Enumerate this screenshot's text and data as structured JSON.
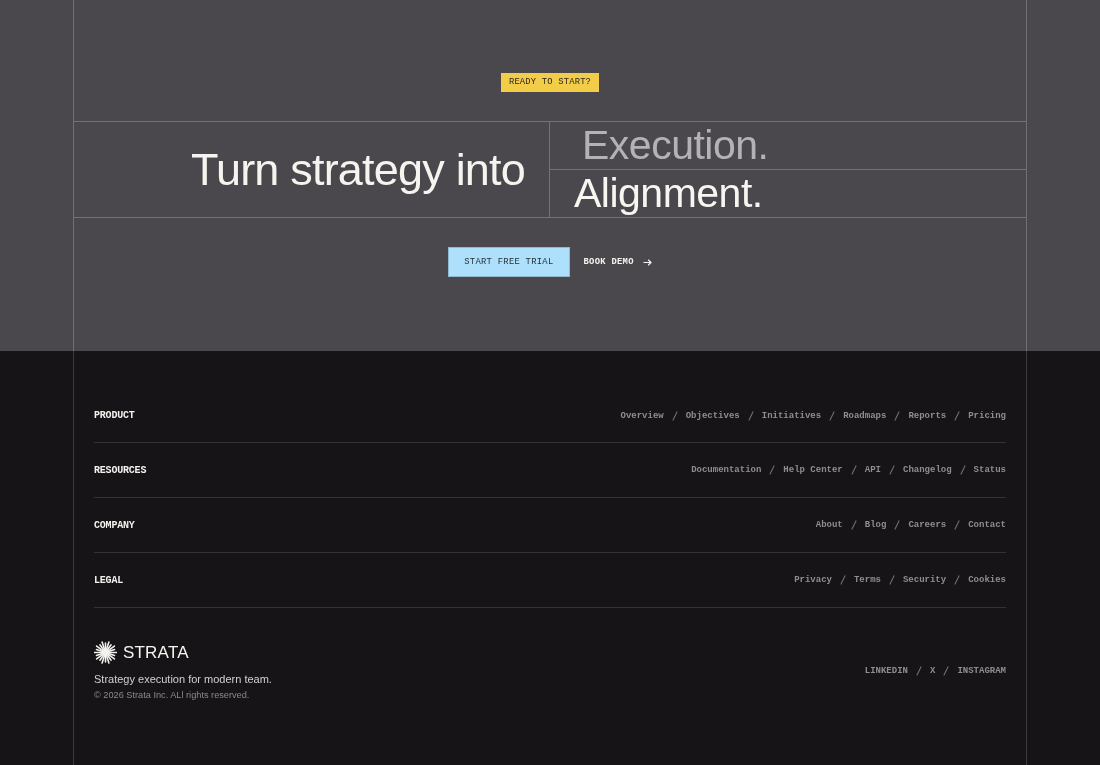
{
  "hero": {
    "badge": "READY TO START?",
    "headline": "Turn strategy into",
    "rotating_words": [
      {
        "text": "Execution.",
        "highlighted": false
      },
      {
        "text": "Alignment.",
        "highlighted": true
      }
    ],
    "buttons": [
      {
        "label": "START FREE TRIAL",
        "kind": "primary"
      },
      {
        "label": "BOOK DEMO",
        "kind": "link"
      }
    ]
  },
  "footer": {
    "sections": [
      {
        "heading": "PRODUCT",
        "links": [
          "Overview",
          "Objectives",
          "Initiatives",
          "Roadmaps",
          "Reports",
          "Pricing"
        ]
      },
      {
        "heading": "RESOURCES",
        "links": [
          "Documentation",
          "Help Center",
          "API",
          "Changelog",
          "Status"
        ]
      },
      {
        "heading": "COMPANY",
        "links": [
          "About",
          "Blog",
          "Careers",
          "Contact"
        ]
      },
      {
        "heading": "LEGAL",
        "links": [
          "Privacy",
          "Terms",
          "Security",
          "Cookies"
        ]
      }
    ],
    "brand": {
      "name": "STRATA",
      "tagline": "Strategy execution for modern team.",
      "copyright": "© 2026 Strata Inc. ALl rights reserved."
    },
    "social_links": [
      "LINKEDIN",
      "X",
      "INSTAGRAM"
    ]
  }
}
